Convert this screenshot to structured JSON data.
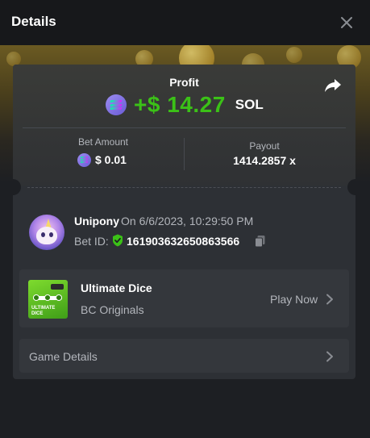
{
  "header": {
    "title": "Details"
  },
  "profit": {
    "label": "Profit",
    "value": "+$ 14.27",
    "unit": "SOL"
  },
  "bet": {
    "label": "Bet Amount",
    "value": "$ 0.01"
  },
  "payout": {
    "label": "Payout",
    "value": "1414.2857 x"
  },
  "user": {
    "name": "Unipony",
    "date": "On 6/6/2023, 10:29:50 PM"
  },
  "bet_id": {
    "label": "Bet ID:",
    "value": "161903632650863566"
  },
  "game": {
    "name": "Ultimate Dice",
    "provider": "BC Originals",
    "play_label": "Play Now",
    "thumb_text": "ULTIMATE DICE"
  },
  "game_details": {
    "label": "Game Details"
  },
  "colors": {
    "profit_green": "#3bc117",
    "background": "#1d1f23",
    "card": "#2d3035"
  },
  "icons": [
    "close-icon",
    "share-icon",
    "solana-icon",
    "shield-check-icon",
    "copy-icon",
    "chevron-right-icon"
  ]
}
